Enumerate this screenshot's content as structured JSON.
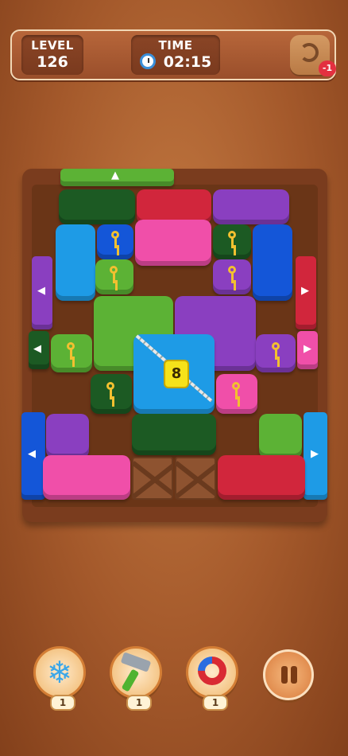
{
  "hud": {
    "level_label": "LEVEL",
    "level_value": "126",
    "time_label": "TIME",
    "time_value": "02:15",
    "undo_cost": "-1"
  },
  "board": {
    "locked_block_number": "8",
    "key_count": 9
  },
  "tools": [
    {
      "name": "freeze",
      "icon": "snowflake",
      "count": "1"
    },
    {
      "name": "hammer",
      "icon": "hammer",
      "count": "1"
    },
    {
      "name": "magnet",
      "icon": "magnet",
      "count": "1"
    }
  ],
  "colors": {
    "green": "#5cb235",
    "dark_green": "#1c5a23",
    "blue": "#1e9be6",
    "dark_blue": "#1456d8",
    "pink": "#f04fa9",
    "purple": "#8a3fc0",
    "red": "#d1263c"
  }
}
